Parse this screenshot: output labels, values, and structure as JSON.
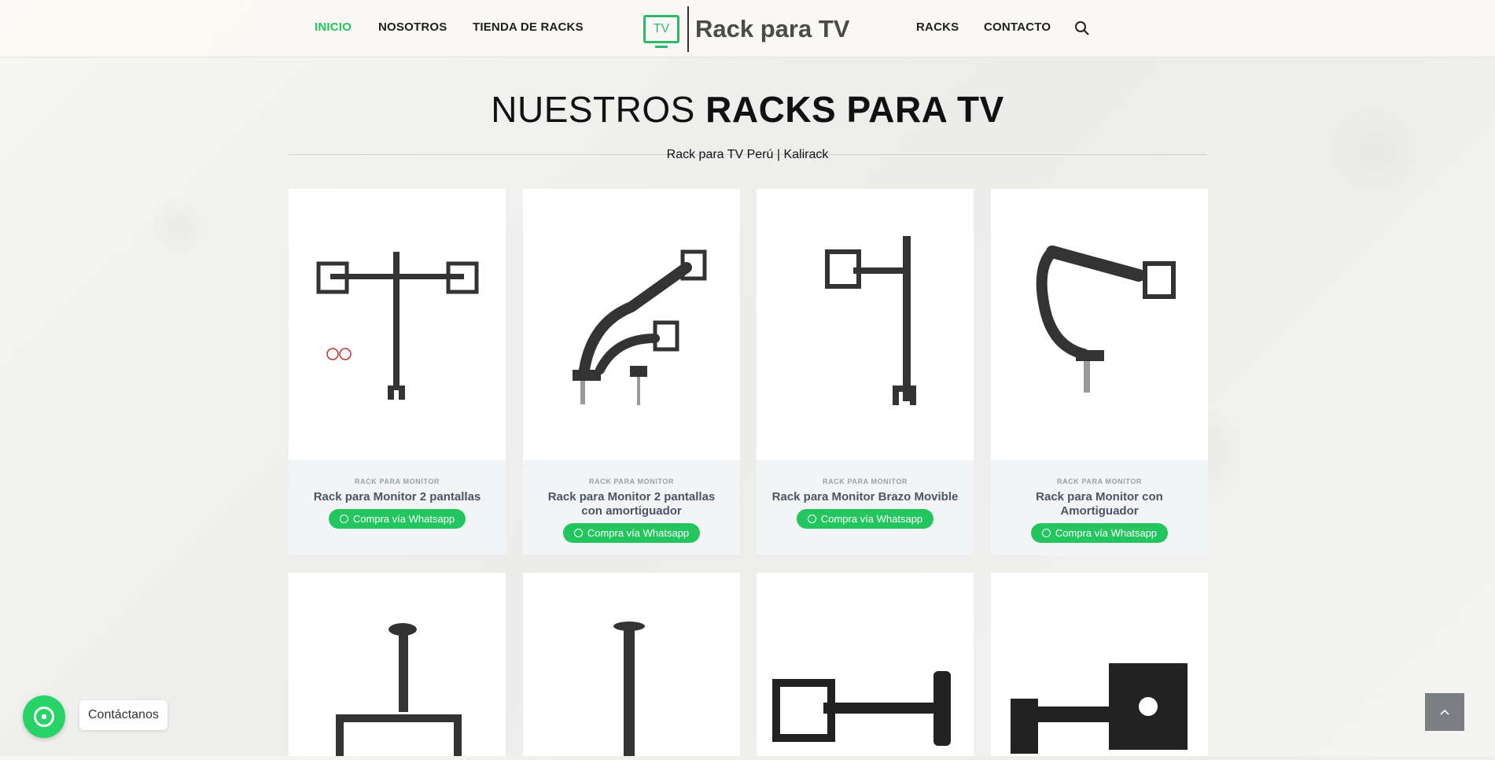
{
  "header": {
    "nav_left": [
      "INICIO",
      "NOSOTROS",
      "TIENDA DE RACKS"
    ],
    "logo_text": "Rack para TV",
    "logo_icon_text": "TV",
    "nav_right": [
      "RACKS",
      "CONTACTO"
    ],
    "accent_color": "#22c55e"
  },
  "section": {
    "title_light": "NUESTROS",
    "title_bold": "RACKS PARA TV",
    "subtitle": "Rack para TV Perú | Kalirack"
  },
  "products": [
    {
      "category": "RACK PARA MONITOR",
      "title": "Rack para Monitor 2 pantallas",
      "button": "Compra vía Whatsapp"
    },
    {
      "category": "RACK PARA MONITOR",
      "title": "Rack para Monitor 2 pantallas con amortiguador",
      "button": "Compra vía Whatsapp"
    },
    {
      "category": "RACK PARA MONITOR",
      "title": "Rack para Monitor Brazo Movible",
      "button": "Compra vía Whatsapp"
    },
    {
      "category": "RACK PARA MONITOR",
      "title": "Rack para Monitor con Amortiguador",
      "button": "Compra vía Whatsapp"
    }
  ],
  "floating": {
    "contact_label": "Contáctanos"
  }
}
